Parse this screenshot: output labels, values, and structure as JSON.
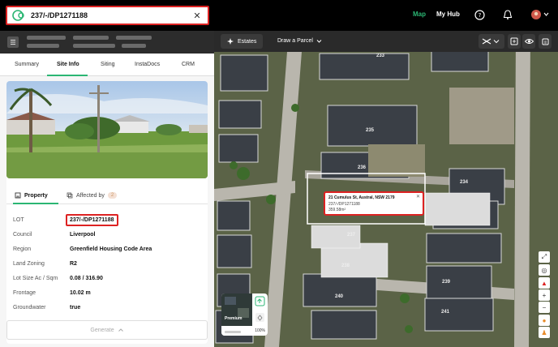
{
  "header": {
    "search_value": "237/-/DP1271188",
    "nav_map": "Map",
    "nav_hub": "My Hub"
  },
  "panel": {
    "tabs": [
      "Summary",
      "Site Info",
      "Siting",
      "InstaDocs",
      "CRM"
    ],
    "active_tab": "Site Info",
    "subtabs": {
      "property": "Property",
      "affected_by": "Affected by",
      "affected_count": "2"
    },
    "fields": [
      {
        "label": "LOT",
        "value": "237/-/DP1271188"
      },
      {
        "label": "Council",
        "value": "Liverpool"
      },
      {
        "label": "Region",
        "value": "Greenfield Housing Code Area"
      },
      {
        "label": "Land Zoning",
        "value": "R2"
      },
      {
        "label": "Lot Size Ac / Sqm",
        "value": "0.08 / 316.90"
      },
      {
        "label": "Frontage",
        "value": "10.02 m"
      },
      {
        "label": "Groundwater",
        "value": "true"
      }
    ],
    "generate_label": "Generate"
  },
  "mapbar": {
    "estates_label": "Estates",
    "draw_label": "Draw a Parcel"
  },
  "popup": {
    "address": "21 Cumulus St, Austral, NSW 2179",
    "lot": "237/-/DP1271188",
    "area": "359.58m²"
  },
  "thumb": {
    "label": "Premium",
    "percent": "100%"
  },
  "map_lots": [
    "233",
    "235",
    "236",
    "237",
    "238",
    "239",
    "240",
    "241",
    "234"
  ],
  "colors": {
    "accent": "#2bb673",
    "highlight": "#dd2222"
  }
}
